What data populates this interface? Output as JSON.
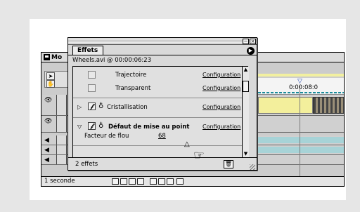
{
  "main_window": {
    "title": "Mo",
    "timecode": "0:00:08:0",
    "marker_icon": "inpoint-marker-icon",
    "status": {
      "duration": "1 seconde"
    }
  },
  "effects_palette": {
    "tab_label": "Effets",
    "clip_info": "Wheels.avi @ 00:00:06:23",
    "effects": [
      {
        "name": "Trajectoire",
        "config": "Configuration"
      },
      {
        "name": "Transparent",
        "config": "Configuration"
      },
      {
        "name": "Cristallisation",
        "config": "Configuration"
      },
      {
        "name": "Défaut de mise au point",
        "config": "Configuration",
        "expanded": true
      }
    ],
    "parameter": {
      "label": "Facteur de flou",
      "value": "68"
    },
    "footer": {
      "count": "2 effets"
    }
  },
  "colors": {
    "background": "#e6e6e6",
    "panel": "#d9d9d9",
    "clip_yellow": "#f3ef9c",
    "clip_teal": "#a7d3d7",
    "accent_blue": "#2a4db3"
  }
}
